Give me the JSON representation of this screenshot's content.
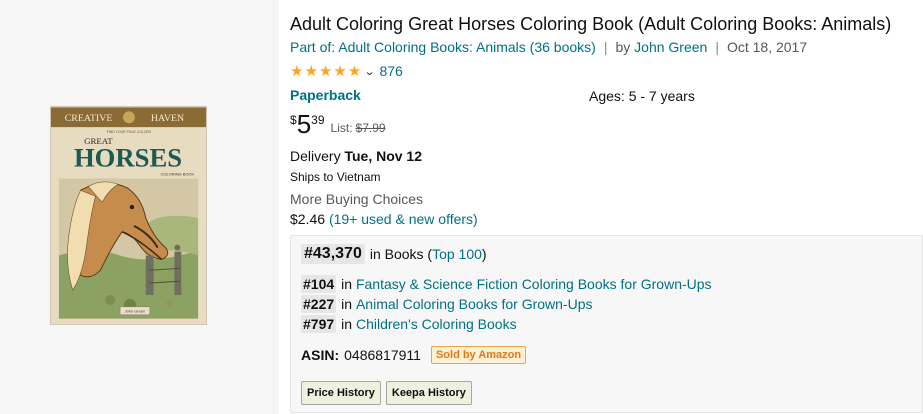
{
  "product": {
    "title": "Adult Coloring Great Horses Coloring Book (Adult Coloring Books: Animals)",
    "series_link": "Part of: Adult Coloring Books: Animals (36 books)",
    "by_prefix": "by",
    "author": "John Green",
    "date": "Oct 18, 2017",
    "rating": 4.7,
    "rating_count": "876",
    "format": "Paperback",
    "ages": "Ages: 5 - 7 years"
  },
  "cover": {
    "brand_left": "CREATIVE",
    "brand_right": "HAVEN",
    "tagline": "FIND YOUR TRUE COLORS",
    "title_top": "GREAT",
    "title_main": "HORSES",
    "subtitle": "COLORING BOOK",
    "author_tag": "John Green"
  },
  "price": {
    "currency": "$",
    "whole": "5",
    "fraction": "39",
    "list_label": "List:",
    "list_price": "$7.99"
  },
  "delivery": {
    "label": "Delivery",
    "date": "Tue, Nov 12",
    "ships_to": "Ships to Vietnam"
  },
  "buying": {
    "label": "More Buying Choices",
    "price": "$2.46",
    "offers_link": "(19+ used & new offers)"
  },
  "ranks": {
    "main_rank": "#43,370",
    "main_in": "in Books (",
    "main_link": "Top 100",
    "main_close": ")",
    "sub": [
      {
        "rank": "#104",
        "in": "in",
        "category": "Fantasy & Science Fiction Coloring Books for Grown-Ups"
      },
      {
        "rank": "#227",
        "in": "in",
        "category": "Animal Coloring Books for Grown-Ups"
      },
      {
        "rank": "#797",
        "in": "in",
        "category": "Children's Coloring Books"
      }
    ]
  },
  "asin": {
    "label": "ASIN:",
    "value": "0486817911",
    "sold_by": "Sold by Amazon"
  },
  "buttons": {
    "price_history": "Price History",
    "keepa_history": "Keepa History"
  },
  "colors": {
    "link": "#007185",
    "star": "#ffa41c",
    "sold_badge": "#e47911"
  }
}
